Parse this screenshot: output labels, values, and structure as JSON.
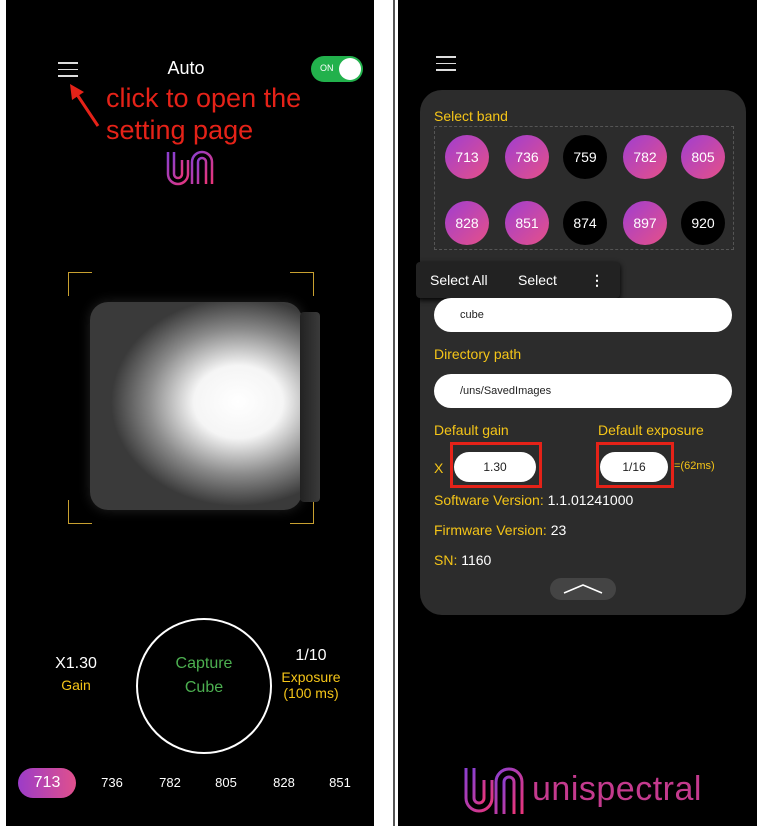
{
  "left": {
    "mode": "Auto",
    "toggle_label": "ON",
    "annotation": "click to open the setting page",
    "gain_value": "X1.30",
    "gain_label": "Gain",
    "capture_line1": "Capture",
    "capture_line2": "Cube",
    "exposure_value": "1/10",
    "exposure_label": "Exposure",
    "exposure_ms": "(100 ms)",
    "bands": [
      "713",
      "736",
      "782",
      "805",
      "828",
      "851"
    ],
    "active_band": "713"
  },
  "right": {
    "select_band_label": "Select band",
    "band_rows": [
      [
        {
          "value": "713",
          "selected": true
        },
        {
          "value": "736",
          "selected": true
        },
        {
          "value": "759",
          "selected": false
        },
        {
          "value": "782",
          "selected": true
        },
        {
          "value": "805",
          "selected": true
        }
      ],
      [
        {
          "value": "828",
          "selected": true
        },
        {
          "value": "851",
          "selected": true
        },
        {
          "value": "874",
          "selected": false
        },
        {
          "value": "897",
          "selected": true
        },
        {
          "value": "920",
          "selected": false
        }
      ]
    ],
    "context_menu": {
      "select_all": "Select All",
      "select": "Select",
      "more": "⋮"
    },
    "filename_value": "cube",
    "directory_label": "Directory path",
    "directory_value": "/uns/SavedImages",
    "default_gain_label": "Default gain",
    "gain_prefix": "X",
    "gain_value": "1.30",
    "default_exposure_label": "Default exposure",
    "exposure_value": "1/16",
    "exposure_ms": "=(62ms)",
    "software_label": "Software Version:",
    "software_value": "1.1.01241000",
    "firmware_label": "Firmware Version:",
    "firmware_value": "23",
    "sn_label": "SN:",
    "sn_value": "1160",
    "brand": "unispectral"
  },
  "colors": {
    "accent_yellow": "#f5c518",
    "annotation_red": "#e52218",
    "band_gradient_start": "#a03ed0",
    "band_gradient_end": "#e65088",
    "capture_green": "#4caf50",
    "toggle_green": "#22b14c"
  }
}
